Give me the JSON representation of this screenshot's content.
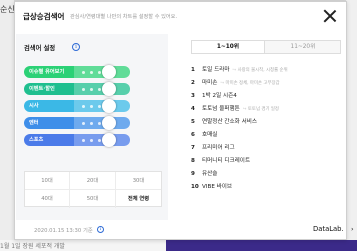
{
  "background": {
    "left_text": "순신",
    "bottom_text": "1월 1일 장원 세포적 개발"
  },
  "modal": {
    "title": "급상승검색어",
    "subtitle": "관심사/연령대별 나만의 차트를 설정할 수 있어요.",
    "close_label": "×"
  },
  "settings": {
    "label": "검색어 설정",
    "info_icon": "i",
    "sliders": [
      {
        "label": "이슈별 유어보기",
        "color": "#2bd176",
        "level": 0.85
      },
      {
        "label": "이벤트·할인",
        "color": "#1fbf8f",
        "level": 0.85
      },
      {
        "label": "시사",
        "color": "#3bb8e6",
        "level": 0.85
      },
      {
        "label": "엔터",
        "color": "#3e8ee9",
        "level": 0.85
      },
      {
        "label": "스포츠",
        "color": "#4b7be9",
        "level": 0.85
      }
    ],
    "ages": [
      {
        "label": "10대"
      },
      {
        "label": "20대"
      },
      {
        "label": "30대"
      },
      {
        "label": "40대"
      },
      {
        "label": "50대"
      },
      {
        "label": "전체 연령"
      }
    ]
  },
  "tabs": [
    {
      "label": "1~10위"
    },
    {
      "label": "11~20위"
    }
  ],
  "rankings": [
    {
      "rank": "1",
      "keyword": "토일 드라마",
      "sub": "사랑의 불시착, 시청률 순위"
    },
    {
      "rank": "2",
      "keyword": "마미손",
      "sub": "마미손 정체, 마미손 고무장갑"
    },
    {
      "rank": "3",
      "keyword": "1박 2일 시즌4",
      "sub": ""
    },
    {
      "rank": "4",
      "keyword": "토토넘 울퍼햄튼",
      "sub": "토토넘 경기 일정"
    },
    {
      "rank": "5",
      "keyword": "연말정산 간소화 서비스",
      "sub": ""
    },
    {
      "rank": "6",
      "keyword": "호매실",
      "sub": ""
    },
    {
      "rank": "7",
      "keyword": "프리미어 리그",
      "sub": ""
    },
    {
      "rank": "8",
      "keyword": "티머니티 디크레이트",
      "sub": ""
    },
    {
      "rank": "9",
      "keyword": "유산슬",
      "sub": ""
    },
    {
      "rank": "10",
      "keyword": "VIBE 바이브",
      "sub": ""
    }
  ],
  "footer": {
    "timestamp": "2020.01.15 13:30 기준",
    "info_icon": "i",
    "datalab": "DataLab.",
    "arrow": "›"
  }
}
